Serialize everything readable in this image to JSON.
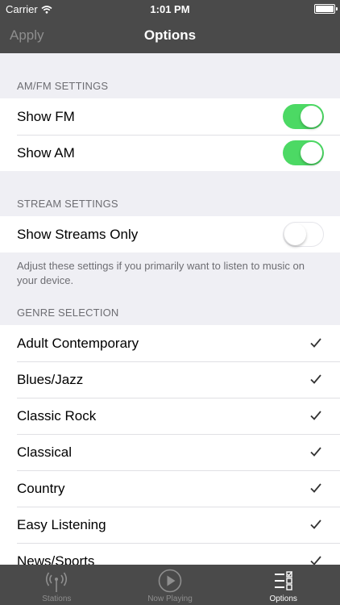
{
  "status": {
    "carrier": "Carrier",
    "time": "1:01 PM"
  },
  "navbar": {
    "apply_label": "Apply",
    "title": "Options"
  },
  "sections": {
    "amfm": {
      "header": "AM/FM SETTINGS",
      "rows": [
        {
          "label": "Show FM",
          "on": true
        },
        {
          "label": "Show AM",
          "on": true
        }
      ]
    },
    "stream": {
      "header": "STREAM SETTINGS",
      "rows": [
        {
          "label": "Show Streams Only",
          "on": false
        }
      ],
      "footer": "Adjust these settings if you primarily want to listen to music on your device."
    },
    "genre": {
      "header": "GENRE SELECTION",
      "items": [
        "Adult Contemporary",
        "Blues/Jazz",
        "Classic Rock",
        "Classical",
        "Country",
        "Easy Listening",
        "News/Sports"
      ]
    }
  },
  "tabbar": {
    "items": [
      {
        "label": "Stations",
        "icon": "antenna-icon",
        "active": false
      },
      {
        "label": "Now Playing",
        "icon": "play-icon",
        "active": false
      },
      {
        "label": "Options",
        "icon": "options-list-icon",
        "active": true
      }
    ]
  },
  "colors": {
    "bar": "#4a4a4a",
    "toggle_on": "#4cd964",
    "background": "#efeff4"
  }
}
